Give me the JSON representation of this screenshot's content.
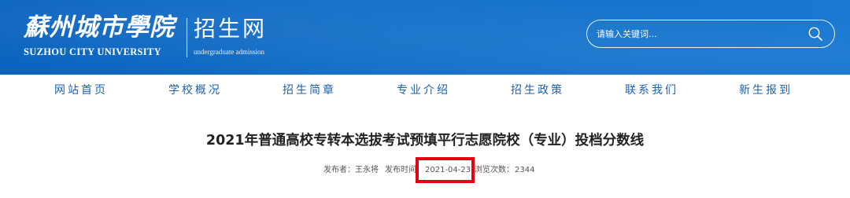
{
  "header": {
    "logo_cn": "蘇州城市學院",
    "logo_en": "SUZHOU CITY UNIVERSITY",
    "site_name": "招生网",
    "site_name_en": "undergraduate admission"
  },
  "search": {
    "placeholder": "请输入关键词..."
  },
  "nav": {
    "items": [
      "网站首页",
      "学校概况",
      "招生简章",
      "专业介绍",
      "招生政策",
      "联系我们",
      "新生报到"
    ]
  },
  "article": {
    "title": "2021年普通高校专转本选拔考试预填平行志愿院校（专业）投档分数线",
    "publisher_label": "发布者：",
    "publisher": "王永将",
    "time_label": "发布时间：",
    "time": "2021-04-23",
    "views_label": "浏览次数：",
    "views": "2344"
  },
  "colors": {
    "header_blue": "#136fc8",
    "nav_text": "#1a62b2",
    "highlight": "#e60012"
  }
}
